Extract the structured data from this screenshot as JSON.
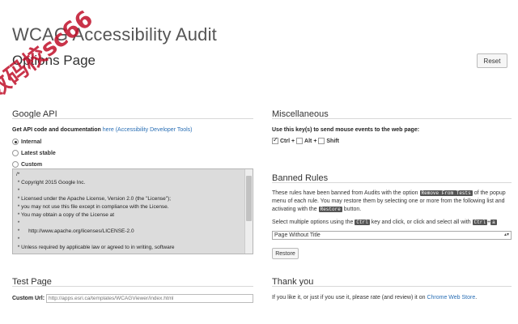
{
  "header": {
    "title": "WCAG Accessibility Audit",
    "subtitle": "Options Page",
    "reset_label": "Reset",
    "watermark_text": "数码校sc66"
  },
  "google_api": {
    "title": "Google API",
    "intro": "Get API code and documentation",
    "link_text": "here (Accessibility Developer Tools)",
    "options": [
      "Internal",
      "Latest stable",
      "Custom"
    ],
    "selected": "Internal",
    "license_lines": [
      "/*",
      " * Copyright 2015 Google Inc.",
      " *",
      " * Licensed under the Apache License, Version 2.0 (the \"License\");",
      " * you may not use this file except in compliance with the License.",
      " * You may obtain a copy of the License at",
      " *",
      " *      http://www.apache.org/licenses/LICENSE-2.0",
      " *",
      " * Unless required by applicable law or agreed to in writing, software"
    ]
  },
  "test_page": {
    "title": "Test Page",
    "label": "Custom Url:",
    "placeholder": "http://apps.esri.ca/templates/WCAGViewer/index.html"
  },
  "misc": {
    "title": "Miscellaneous",
    "description": "Use this key(s) to send mouse events to the web page:",
    "keys": [
      {
        "label": "Ctrl +",
        "checked": true
      },
      {
        "label": "Alt +",
        "checked": false
      },
      {
        "label": "Shift",
        "checked": false
      }
    ]
  },
  "banned": {
    "title": "Banned Rules",
    "p1_a": "These rules have been banned from Audits with the option",
    "p1_kbd1": "Remove From Tests",
    "p1_b": "of the popup",
    "p1_c": "menu of each rule. You may restore them by selecting one or more from the following list",
    "p1_d": "and activating with the",
    "p1_kbd2": "Restore",
    "p1_e": "button.",
    "p2_a": "Select multiple options using the",
    "p2_kbd1": "Ctrl",
    "p2_b": "key and click, or click and select all with",
    "p2_kbd2": "Ctrl",
    "p2_plus": "+",
    "p2_kbd3": "a",
    "select_value": "Page Without Title",
    "restore_label": "Restore"
  },
  "thanks": {
    "title": "Thank you",
    "text_a": "If you like it, or just if you use it, please rate (and review) it on",
    "link": "Chrome Web Store",
    "text_b": "."
  }
}
